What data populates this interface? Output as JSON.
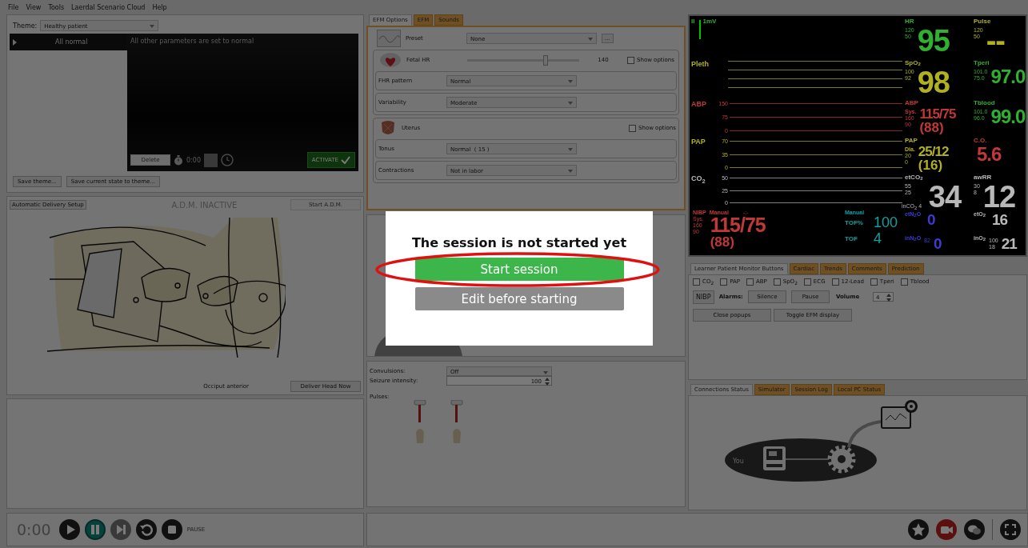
{
  "menu": [
    "File",
    "View",
    "Tools",
    "Laerdal Scenario Cloud",
    "Help"
  ],
  "theme_panel": {
    "theme_label": "Theme:",
    "theme": "Healthy patient",
    "states": [
      {
        "label": "All normal",
        "selected": true
      }
    ],
    "description": "All other parameters are set to normal",
    "delete_button": {
      "label": "Delete",
      "disabled": true
    },
    "timer": "0:00",
    "activate_button": "ACTIVATE",
    "buttons": [
      "Save theme...",
      "Save current state to theme..."
    ]
  },
  "adm_panel": {
    "setup_button": "Automatic Delivery Setup",
    "status": "A.D.M. INACTIVE",
    "start_button": {
      "label": "Start A.D.M.",
      "disabled": true
    },
    "position": "Occiput anterior",
    "deliver_button": "Deliver Head Now"
  },
  "efm": {
    "tabs": [
      {
        "label": "EFM Options",
        "selected": true
      },
      {
        "label": "EFM",
        "selected": false
      },
      {
        "label": "Sounds",
        "selected": false
      }
    ],
    "preset": {
      "label": "Preset",
      "value": "None",
      "more_button": "..."
    },
    "groups": [
      {
        "kind": "fetal",
        "label": "Fetal HR",
        "slider": {
          "level": 0.7,
          "reading": "140"
        },
        "show_options": {
          "label": "Show options",
          "checked": false
        },
        "rows": [
          {
            "label": "FHR pattern",
            "value": "Normal"
          },
          {
            "label": "Variability",
            "value": "Moderate"
          }
        ]
      },
      {
        "kind": "uterus",
        "label": "Uterus",
        "show_options": {
          "label": "Show options",
          "checked": false
        },
        "rows": [
          {
            "label": "Tonus",
            "value": "Normal  ( 15 )"
          },
          {
            "label": "Contractions",
            "value": "Not in labor"
          }
        ]
      }
    ]
  },
  "dialog": {
    "message": "The session is not started yet",
    "buttons": [
      {
        "label": "Start session",
        "kind": "primary",
        "highlighted": true
      },
      {
        "label": "Edit before starting",
        "kind": "secondary",
        "highlighted": false
      }
    ]
  },
  "seizure_panel": {
    "convulsions_label": "Convulsions:",
    "convulsions": "Off",
    "intensity_label": "Seizure intensity:",
    "intensity": "100",
    "pulses_label": "Pulses:"
  },
  "monitor": {
    "ecg": {
      "lead": "II",
      "scale": "1mV"
    },
    "waves": [
      {
        "label": "Pleth",
        "color": "#b0b020"
      },
      {
        "label": "ABP",
        "color": "#c03838",
        "ticks": [
          "150",
          "75",
          "0"
        ]
      },
      {
        "label": "PAP",
        "color": "#b0b020",
        "ticks": [
          "70",
          "35",
          "0"
        ]
      },
      {
        "label": "CO$_{2}$",
        "color": "#b8b8b8",
        "ticks": [
          "50",
          "25",
          "0"
        ]
      }
    ],
    "numerics": [
      {
        "label": "HR",
        "limits": [
          "120",
          "50"
        ],
        "value": "95",
        "color": "#30b030"
      },
      {
        "label": "Pulse",
        "limits": [
          "120",
          "50"
        ],
        "value": "--",
        "color": "#b0b020"
      },
      {
        "label": "SpO$_{2}$",
        "limits": [
          "100",
          "92"
        ],
        "value": "98",
        "color": "#b0b020"
      },
      {
        "label": "Tperi",
        "limits": [
          "101.0",
          "75.0"
        ],
        "value": "97.0",
        "color": "#30b030"
      },
      {
        "label": "ABP",
        "prefix": "Sys.",
        "limits": [
          "160",
          "90"
        ],
        "value": "115/75",
        "mean": "(88)",
        "color": "#c03838"
      },
      {
        "label": "Tblood",
        "limits": [
          "101.0",
          "96.0"
        ],
        "value": "99.0",
        "color": "#30b030"
      },
      {
        "label": "PAP",
        "prefix": "Dia.",
        "limits": [
          "20",
          "0"
        ],
        "value": "25/12",
        "mean": "(16)",
        "color": "#b0b020"
      },
      {
        "label": "C.O.",
        "value": "5.6",
        "color": "#c03838"
      },
      {
        "label": "etCO$_{2}$",
        "limits": [
          "55",
          "25"
        ],
        "value": "34",
        "color": "#b8b8b8",
        "footnote": "inCO$_{2}$ 4"
      },
      {
        "label": "awRR",
        "limits": [
          "30",
          "8"
        ],
        "value": "12",
        "color": "#b8b8b8"
      }
    ],
    "nibp": {
      "label": "NIBP",
      "mode": "Manual",
      "time": "-:-",
      "prefix": "Sys.",
      "limits": [
        "160",
        "90"
      ],
      "value": "115/75",
      "mean": "(88)"
    },
    "tof": {
      "mode": "Manual",
      "items": [
        {
          "label": "TOF%",
          "value": "100"
        },
        {
          "label": "TOF",
          "value": "4"
        }
      ]
    },
    "gases": [
      {
        "label": "etN$_{2}$O",
        "value": "0",
        "color": "#3c3cd0"
      },
      {
        "label": "inN$_{2}$O",
        "limits": [
          "82"
        ],
        "value": "0",
        "color": "#3c3cd0"
      },
      {
        "label": "etO$_{2}$",
        "value": "16",
        "color": "#b8b8b8"
      },
      {
        "label": "inO$_{2}$",
        "limits": [
          "100",
          "18"
        ],
        "value": "21",
        "color": "#b8b8b8"
      }
    ]
  },
  "monitor_buttons": {
    "tabs": [
      {
        "label": "Learner Patient Monitor Buttons",
        "selected": true
      },
      {
        "label": "Cardiac",
        "selected": false
      },
      {
        "label": "Trends",
        "selected": false
      },
      {
        "label": "Comments",
        "selected": false
      },
      {
        "label": "Prediction",
        "selected": false
      }
    ],
    "checkboxes": [
      {
        "label": "CO$_{2}$",
        "checked": false
      },
      {
        "label": "PAP",
        "checked": false
      },
      {
        "label": "ABP",
        "checked": false
      },
      {
        "label": "SpO$_{2}$",
        "checked": false
      },
      {
        "label": "ECG",
        "checked": false
      },
      {
        "label": "12-Lead",
        "checked": false
      },
      {
        "label": "Tperi",
        "checked": false
      },
      {
        "label": "Tblood",
        "checked": false
      }
    ],
    "nibp_button": "NIBP",
    "alarms_label": "Alarms:",
    "alarm_buttons": [
      "Silence",
      "Pause"
    ],
    "volume_label": "Volume",
    "volume": "4",
    "buttons": [
      "Close popups",
      "Toggle EFM display"
    ]
  },
  "connections": {
    "tabs": [
      {
        "label": "Connections Status",
        "selected": true
      },
      {
        "label": "Simulator",
        "selected": false
      },
      {
        "label": "Session Log",
        "selected": false
      },
      {
        "label": "Local PC Status",
        "selected": false
      }
    ],
    "you_label": "You"
  },
  "playback": {
    "time": "0:00",
    "controls": [
      {
        "kind": "play",
        "selected": false,
        "disabled": false
      },
      {
        "kind": "pause",
        "selected": true,
        "disabled": false
      },
      {
        "kind": "next",
        "selected": false,
        "disabled": true
      },
      {
        "kind": "restart",
        "selected": false,
        "disabled": false
      },
      {
        "kind": "stop",
        "selected": false,
        "disabled": false
      }
    ],
    "status": "PAUSE"
  },
  "toolbar": [
    {
      "kind": "star"
    },
    {
      "kind": "video"
    },
    {
      "kind": "chat"
    },
    {
      "kind": "fullscreen"
    }
  ]
}
